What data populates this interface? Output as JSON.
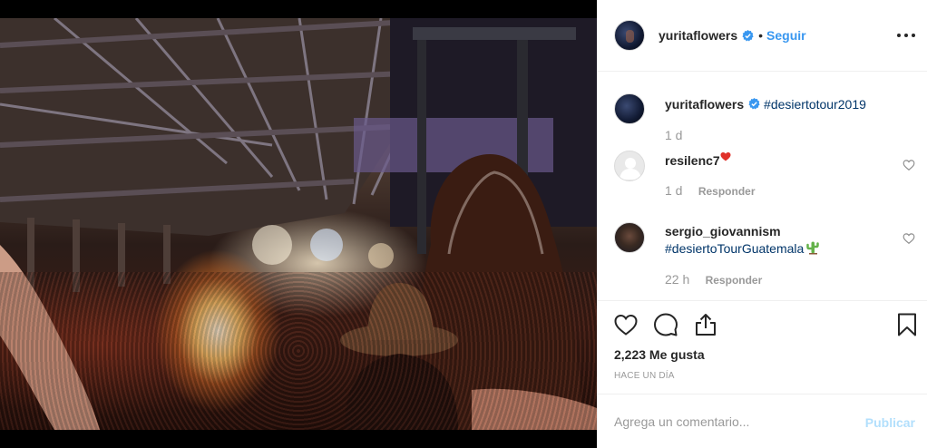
{
  "post": {
    "image_alt": "Concert crowd under a stage roof, singer with long hair and a person in a cowboy hat in the foreground"
  },
  "header": {
    "username": "yuritaflowers",
    "separator": "•",
    "follow_label": "Seguir"
  },
  "comments": [
    {
      "username": "yuritaflowers",
      "text": "#desiertotour2019",
      "time": "1 d",
      "reply_label": ""
    },
    {
      "username": "resilenc7",
      "text": "",
      "time": "1 d",
      "reply_label": "Responder"
    },
    {
      "username": "sergio_giovannism",
      "text": "#desiertoTourGuatemala",
      "time": "22 h",
      "reply_label": "Responder"
    }
  ],
  "actions": {
    "likes": "2,223 Me gusta",
    "timestamp": "Hace un día"
  },
  "add_comment": {
    "placeholder": "Agrega un comentario...",
    "publish_label": "Publicar"
  },
  "colors": {
    "link": "#3897f0",
    "hashtag": "#003569",
    "muted": "#999999",
    "publish_disabled": "#b2dffc",
    "verified": "#3897f0"
  },
  "icons": [
    "verified-badge-icon",
    "more-options-icon",
    "heart-icon",
    "comment-icon",
    "share-icon",
    "bookmark-icon",
    "red-heart-emoji",
    "cactus-emoji"
  ]
}
